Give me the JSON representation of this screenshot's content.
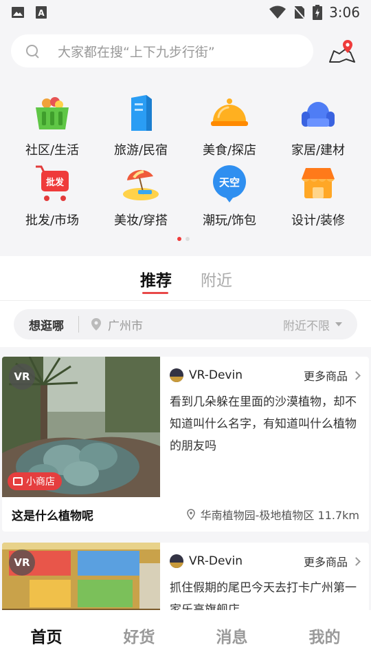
{
  "status_bar": {
    "time": "3:06"
  },
  "search": {
    "placeholder": "大家都在搜“上下九步行街”"
  },
  "categories": [
    {
      "label": "社区/生活",
      "icon": "basket-icon"
    },
    {
      "label": "旅游/民宿",
      "icon": "building-icon"
    },
    {
      "label": "美食/探店",
      "icon": "food-cloche-icon"
    },
    {
      "label": "家居/建材",
      "icon": "sofa-icon"
    },
    {
      "label": "批发/市场",
      "icon": "wholesale-cart-icon",
      "badge": "批发"
    },
    {
      "label": "美妆/穿搭",
      "icon": "beach-umbrella-icon"
    },
    {
      "label": "潮玩/饰包",
      "icon": "sky-bubble-icon",
      "badge": "天空"
    },
    {
      "label": "设计/装修",
      "icon": "storefront-icon"
    }
  ],
  "tabs": {
    "recommend": "推荐",
    "nearby": "附近"
  },
  "filter": {
    "want": "想逛哪",
    "city": "广州市",
    "range": "附近不限"
  },
  "cards": [
    {
      "vr": "VR",
      "shop_tag": "小商店",
      "author": "VR-Devin",
      "more": "更多商品",
      "desc": "看到几朵躲在里面的沙漠植物，却不知道叫什么名字，有知道叫什么植物的朋友吗",
      "title": "这是什么植物呢",
      "location": "华南植物园-极地植物区 11.7km"
    },
    {
      "vr": "VR",
      "author": "VR-Devin",
      "more": "更多商品",
      "desc": "抓住假期的尾巴今天去打卡广州第一家乐高旗舰店"
    }
  ],
  "nav": {
    "home": "首页",
    "goods": "好货",
    "messages": "消息",
    "mine": "我的"
  },
  "colors": {
    "accent": "#e84848",
    "background": "#f5f5f7"
  }
}
